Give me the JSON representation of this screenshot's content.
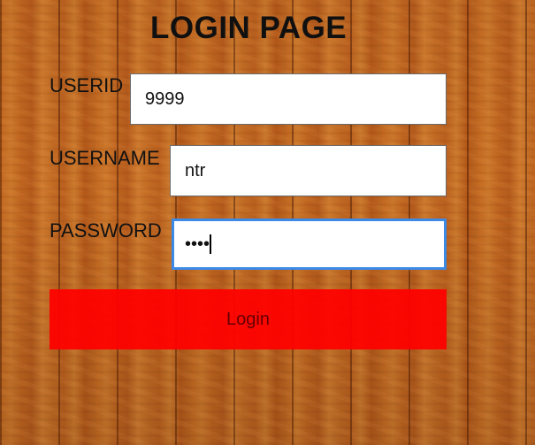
{
  "page": {
    "title": "LOGIN PAGE"
  },
  "form": {
    "userid": {
      "label": "USERID",
      "value": "9999"
    },
    "username": {
      "label": "USERNAME",
      "value": "ntr"
    },
    "password": {
      "label": "PASSWORD",
      "value": "••••"
    },
    "submit_label": "Login"
  },
  "colors": {
    "button": "#ff0000",
    "focus_border": "#3d8ae6",
    "background": "#c66a22"
  }
}
